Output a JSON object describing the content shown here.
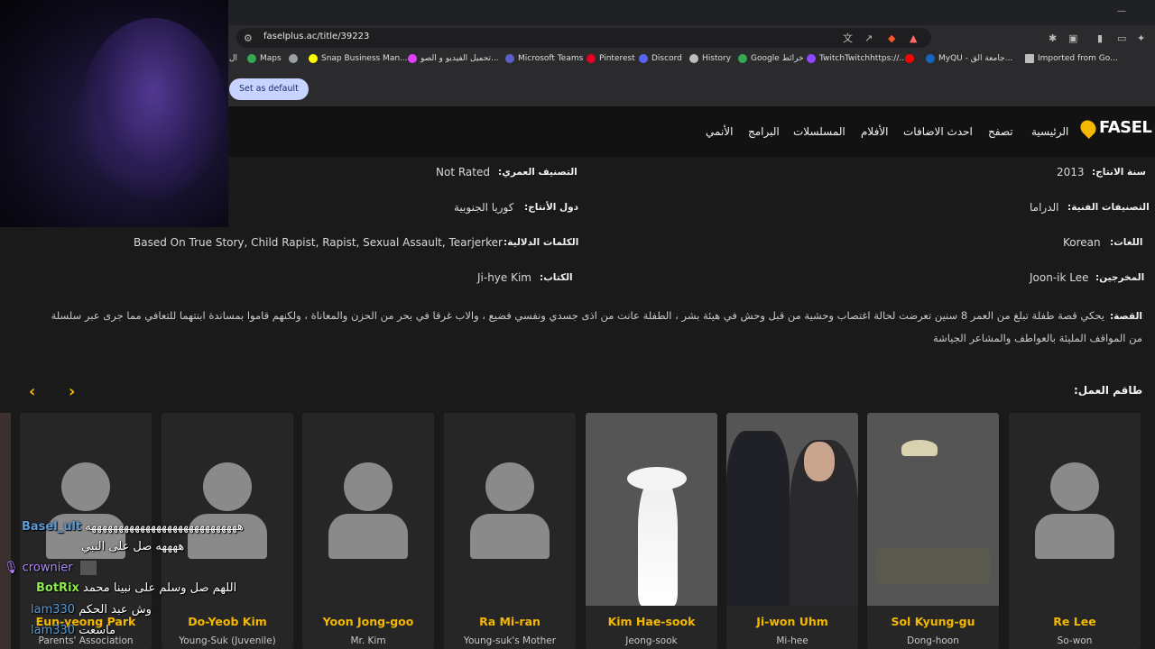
{
  "browser": {
    "url": "faselplus.ac/title/39223",
    "set_default_label": "Set as default",
    "bookmarks": [
      {
        "label": "ال",
        "color": "#4a4a4a"
      },
      {
        "label": "Maps",
        "color": "#34a853"
      },
      {
        "label": "",
        "color": "#9aa0a6"
      },
      {
        "label": "Snap Business Man...",
        "color": "#fffc00"
      },
      {
        "label": "تحميل الفيديو و الصو...",
        "color": "#e040fb"
      },
      {
        "label": "Microsoft Teams",
        "color": "#5b5fc7"
      },
      {
        "label": "Pinterest",
        "color": "#e60023"
      },
      {
        "label": "Discord",
        "color": "#5865f2"
      },
      {
        "label": "History",
        "color": "#bdbdbd"
      },
      {
        "label": "Google خرائط",
        "color": "#34a853"
      },
      {
        "label": "TwitchTwitchhttps://...",
        "color": "#9146ff"
      },
      {
        "label": "",
        "color": "#ff0000"
      },
      {
        "label": "MyQU - جامعة الق...",
        "color": "#1565c0"
      },
      {
        "label": "Imported from Go...",
        "color": "#bdbdbd"
      }
    ]
  },
  "site": {
    "logo_text": "FASEL",
    "logo_plus": "+",
    "nav": [
      "الرئيسية",
      "تصفح",
      "احدث الاضافات",
      "الأفلام",
      "المسلسلات",
      "البرامج",
      "الأنمي"
    ],
    "colors": {
      "accent": "#f5b800"
    }
  },
  "info": {
    "year_label": "سنة الانتاج:",
    "year_value": "2013",
    "rating_label": "التصنيف العمري:",
    "rating_value": "Not Rated",
    "genres_label": "التصنيفات الفنية:",
    "genres_value": "الدراما",
    "countries_label": "دول الأنتاج:",
    "countries_value": "كوريا الجنوبية",
    "language_label": "اللغات:",
    "language_value": "Korean",
    "keywords_label": "الكلمات الدلالية:",
    "keywords_value": "Based On True Story, Child Rapist, Rapist, Sexual Assault, Tearjerker",
    "directors_label": "المخرجين:",
    "directors_value": "Joon-ik Lee",
    "writers_label": "الكتاب:",
    "writers_value": "Ji-hye Kim",
    "story_label": "القصة:",
    "story_value": "يحكي قصة طفلة تبلغ من العمر 8 سنين تعرضت لحالة اغتصاب وحشية من قبل وحش في هيئة بشر ، الطفلة عانت من اذى جسدي ونفسي فضيع ، والاب غرقا في بحر من الحزن والمعاناة ، ولكنهم قاموا بمساندة ابنتهما للتعافي مما جرى عبر سلسلة من المواقف المليئة بالعواطف والمشاعر الجياشة"
  },
  "cast": {
    "heading": "طاقم العمل:",
    "members": [
      {
        "name": "Re Lee",
        "role": "So-won",
        "photo": "placeholder"
      },
      {
        "name": "Sol Kyung-gu",
        "role": "Dong-hoon",
        "photo": "bar-scene"
      },
      {
        "name": "Ji-won Uhm",
        "role": "Mi-hee",
        "photo": "suit-scene"
      },
      {
        "name": "Kim Hae-sook",
        "role": "Jeong-sook",
        "photo": "sky-scene"
      },
      {
        "name": "Ra Mi-ran",
        "role": "Young-suk's Mother",
        "photo": "placeholder"
      },
      {
        "name": "Yoon Jong-goo",
        "role": "Mr. Kim",
        "photo": "placeholder"
      },
      {
        "name": "Do-Yeob Kim",
        "role": "Young-Suk (Juvenile)",
        "photo": "placeholder"
      },
      {
        "name": "Eun-yeong Park",
        "role": "Parents' Association",
        "photo": "placeholder"
      }
    ]
  },
  "chat": [
    {
      "user": "Basel_ult",
      "color": "#5b9bd5",
      "msg": "ههههههههههههههههههههههههههههه"
    },
    {
      "user": "",
      "color": "#ffffff",
      "msg": "ههههه صل على النبي"
    },
    {
      "user": "crownier",
      "color": "#b388ff",
      "msg": ""
    },
    {
      "user": "BotRix",
      "color": "#8ee84f",
      "msg": "اللهم صل وسلم على نبينا محمد"
    },
    {
      "user": "lam330",
      "color": "#5b9bd5",
      "msg": "وش عبد الحكم"
    },
    {
      "user": "lam330",
      "color": "#5b9bd5",
      "msg": "ماسعت"
    }
  ]
}
